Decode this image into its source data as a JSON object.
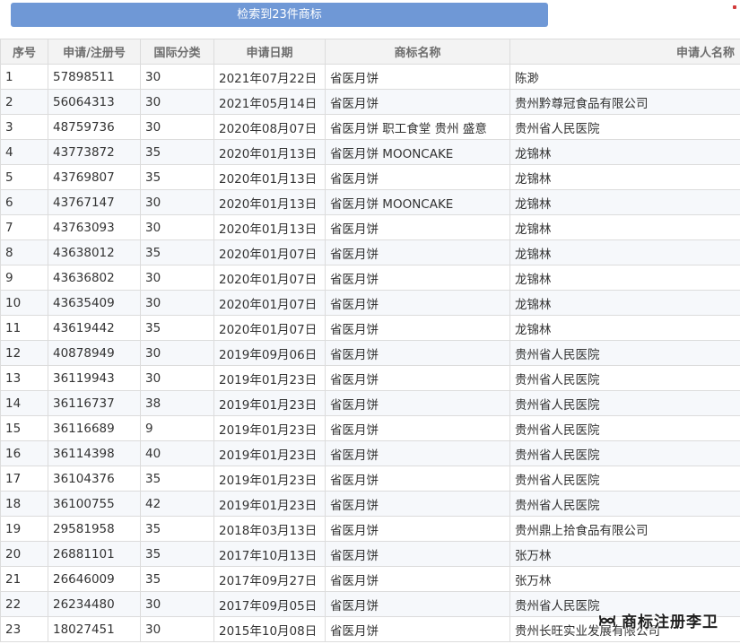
{
  "result_button_label": "检索到23件商标",
  "columns": {
    "seq": "序号",
    "reg_no": "申请/注册号",
    "class": "国际分类",
    "date": "申请日期",
    "mark": "商标名称",
    "applicant": "申请人名称"
  },
  "rows": [
    {
      "seq": "1",
      "reg_no": "57898511",
      "class": "30",
      "date": "2021年07月22日",
      "mark": "省医月饼",
      "applicant": "陈渺"
    },
    {
      "seq": "2",
      "reg_no": "56064313",
      "class": "30",
      "date": "2021年05月14日",
      "mark": "省医月饼",
      "applicant": "贵州黔尊冠食品有限公司"
    },
    {
      "seq": "3",
      "reg_no": "48759736",
      "class": "30",
      "date": "2020年08月07日",
      "mark": "省医月饼 职工食堂 贵州 盛意",
      "applicant": "贵州省人民医院"
    },
    {
      "seq": "4",
      "reg_no": "43773872",
      "class": "35",
      "date": "2020年01月13日",
      "mark": "省医月饼 MOONCAKE",
      "applicant": "龙锦林"
    },
    {
      "seq": "5",
      "reg_no": "43769807",
      "class": "35",
      "date": "2020年01月13日",
      "mark": "省医月饼",
      "applicant": "龙锦林"
    },
    {
      "seq": "6",
      "reg_no": "43767147",
      "class": "30",
      "date": "2020年01月13日",
      "mark": "省医月饼 MOONCAKE",
      "applicant": "龙锦林"
    },
    {
      "seq": "7",
      "reg_no": "43763093",
      "class": "30",
      "date": "2020年01月13日",
      "mark": "省医月饼",
      "applicant": "龙锦林"
    },
    {
      "seq": "8",
      "reg_no": "43638012",
      "class": "35",
      "date": "2020年01月07日",
      "mark": "省医月饼",
      "applicant": "龙锦林"
    },
    {
      "seq": "9",
      "reg_no": "43636802",
      "class": "30",
      "date": "2020年01月07日",
      "mark": "省医月饼",
      "applicant": "龙锦林"
    },
    {
      "seq": "10",
      "reg_no": "43635409",
      "class": "30",
      "date": "2020年01月07日",
      "mark": "省医月饼",
      "applicant": "龙锦林"
    },
    {
      "seq": "11",
      "reg_no": "43619442",
      "class": "35",
      "date": "2020年01月07日",
      "mark": "省医月饼",
      "applicant": "龙锦林"
    },
    {
      "seq": "12",
      "reg_no": "40878949",
      "class": "30",
      "date": "2019年09月06日",
      "mark": "省医月饼",
      "applicant": "贵州省人民医院"
    },
    {
      "seq": "13",
      "reg_no": "36119943",
      "class": "30",
      "date": "2019年01月23日",
      "mark": "省医月饼",
      "applicant": "贵州省人民医院"
    },
    {
      "seq": "14",
      "reg_no": "36116737",
      "class": "38",
      "date": "2019年01月23日",
      "mark": "省医月饼",
      "applicant": "贵州省人民医院"
    },
    {
      "seq": "15",
      "reg_no": "36116689",
      "class": "9",
      "date": "2019年01月23日",
      "mark": "省医月饼",
      "applicant": "贵州省人民医院"
    },
    {
      "seq": "16",
      "reg_no": "36114398",
      "class": "40",
      "date": "2019年01月23日",
      "mark": "省医月饼",
      "applicant": "贵州省人民医院"
    },
    {
      "seq": "17",
      "reg_no": "36104376",
      "class": "35",
      "date": "2019年01月23日",
      "mark": "省医月饼",
      "applicant": "贵州省人民医院"
    },
    {
      "seq": "18",
      "reg_no": "36100755",
      "class": "42",
      "date": "2019年01月23日",
      "mark": "省医月饼",
      "applicant": "贵州省人民医院"
    },
    {
      "seq": "19",
      "reg_no": "29581958",
      "class": "35",
      "date": "2018年03月13日",
      "mark": "省医月饼",
      "applicant": "贵州鼎上拾食品有限公司"
    },
    {
      "seq": "20",
      "reg_no": "26881101",
      "class": "35",
      "date": "2017年10月13日",
      "mark": "省医月饼",
      "applicant": "张万林"
    },
    {
      "seq": "21",
      "reg_no": "26646009",
      "class": "35",
      "date": "2017年09月27日",
      "mark": "省医月饼",
      "applicant": "张万林"
    },
    {
      "seq": "22",
      "reg_no": "26234480",
      "class": "30",
      "date": "2017年09月05日",
      "mark": "省医月饼",
      "applicant": "贵州省人民医院"
    },
    {
      "seq": "23",
      "reg_no": "18027451",
      "class": "30",
      "date": "2015年10月08日",
      "mark": "省医月饼",
      "applicant": "贵州长旺实业发展有限公司"
    }
  ],
  "watermark": {
    "icon": "wechat-channel-icon",
    "text": "商标注册李卫"
  },
  "colors": {
    "button_bg": "#6f98d6",
    "link": "#2a7bbf",
    "header_bg": "#f3f3f3",
    "stripe": "#f6f8fb"
  }
}
